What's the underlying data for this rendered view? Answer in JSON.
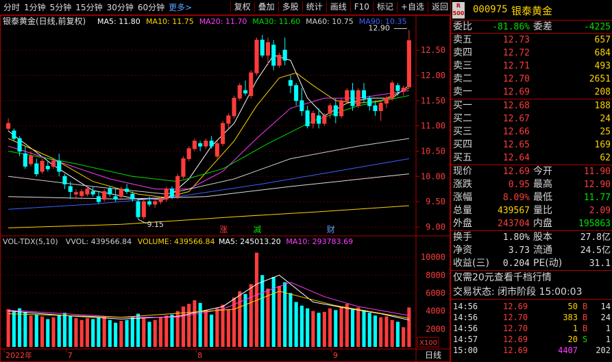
{
  "toolbar": {
    "items": [
      "分时",
      "1分钟",
      "5分钟",
      "15分钟",
      "30分钟",
      "60分钟",
      "更多>"
    ],
    "right": [
      "复权",
      "叠加",
      "多股",
      "统计",
      "画线",
      "F10",
      "标记",
      "+自选",
      "返回"
    ]
  },
  "chart": {
    "title": "银泰黄金(日线,前复权)",
    "ma_labels": [
      {
        "text": "MA5: 11.80",
        "color": "#ffffff"
      },
      {
        "text": "MA10: 11.75",
        "color": "#ffd400"
      },
      {
        "text": "MA20: 11.70",
        "color": "#ff3cff"
      },
      {
        "text": "MA30: 11.60",
        "color": "#00e000"
      },
      {
        "text": "MA60: 10.75",
        "color": "#d0d0d0"
      },
      {
        "text": "MA90: 10.35",
        "color": "#4060ff"
      }
    ],
    "price_ticks": [
      "12.50",
      "12.00",
      "11.50",
      "11.00",
      "10.50",
      "10.00",
      "9.50",
      "9.00"
    ],
    "high_label": "12.90",
    "low_label": "9.15",
    "markers": [
      {
        "t": "涨",
        "c": "#ff3c3c"
      },
      {
        "t": "减",
        "c": "#00e000"
      },
      {
        "t": "财",
        "c": "#5aa0ff"
      }
    ],
    "vol_labels": [
      {
        "text": "VOL-TDX(5,10)",
        "color": "#d0d0d0"
      },
      {
        "text": "VVOL: 439566.84",
        "color": "#d0d0d0"
      },
      {
        "text": "VOLUME: 439566.84",
        "color": "#ffd400"
      },
      {
        "text": "MA5: 245013.20",
        "color": "#ffffff"
      },
      {
        "text": "MA10: 293783.69",
        "color": "#ff3cff"
      }
    ],
    "vol_ticks": [
      "10000",
      "8000",
      "6000",
      "4000",
      "2000"
    ],
    "vol_unit": "X100",
    "x_labels": [
      "2022年",
      "7",
      "8",
      "9"
    ],
    "period": "日线"
  },
  "chart_data": {
    "type": "candlestick",
    "price_range": [
      8.85,
      12.95
    ],
    "vol_range": [
      0,
      11000
    ],
    "candles": [
      [
        10.95,
        11.15,
        10.9,
        11.05
      ],
      [
        10.9,
        10.95,
        10.7,
        10.75
      ],
      [
        10.75,
        10.8,
        10.4,
        10.5
      ],
      [
        10.45,
        10.6,
        10.15,
        10.2
      ],
      [
        10.25,
        10.5,
        10.2,
        10.4
      ],
      [
        10.25,
        10.35,
        10.0,
        10.05
      ],
      [
        10.1,
        10.35,
        10.05,
        10.3
      ],
      [
        10.2,
        10.3,
        10.1,
        10.15
      ],
      [
        10.2,
        10.35,
        10.15,
        10.3
      ],
      [
        10.3,
        10.45,
        10.0,
        10.1
      ],
      [
        10.0,
        10.05,
        9.75,
        9.85
      ],
      [
        9.8,
        9.9,
        9.55,
        9.7
      ],
      [
        9.65,
        9.75,
        9.55,
        9.68
      ],
      [
        9.62,
        9.75,
        9.55,
        9.7
      ],
      [
        9.65,
        9.8,
        9.6,
        9.75
      ],
      [
        9.7,
        9.8,
        9.6,
        9.65
      ],
      [
        9.6,
        9.7,
        9.45,
        9.5
      ],
      [
        9.55,
        9.75,
        9.5,
        9.7
      ],
      [
        9.75,
        9.8,
        9.6,
        9.65
      ],
      [
        9.6,
        9.75,
        9.5,
        9.55
      ],
      [
        9.6,
        9.8,
        9.55,
        9.75
      ],
      [
        9.75,
        9.85,
        9.65,
        9.7
      ],
      [
        9.65,
        9.7,
        9.5,
        9.55
      ],
      [
        9.5,
        9.55,
        9.15,
        9.2
      ],
      [
        9.2,
        9.55,
        9.15,
        9.5
      ],
      [
        9.5,
        9.6,
        9.4,
        9.45
      ],
      [
        9.45,
        9.55,
        9.38,
        9.5
      ],
      [
        9.5,
        9.6,
        9.45,
        9.55
      ],
      [
        9.55,
        9.8,
        9.5,
        9.75
      ],
      [
        9.75,
        9.8,
        9.55,
        9.6
      ],
      [
        9.6,
        10.05,
        9.55,
        10.0
      ],
      [
        10.0,
        10.4,
        9.95,
        10.35
      ],
      [
        10.35,
        10.6,
        10.3,
        10.55
      ],
      [
        10.55,
        10.75,
        10.5,
        10.7
      ],
      [
        10.65,
        10.7,
        10.5,
        10.6
      ],
      [
        10.6,
        10.75,
        10.55,
        10.7
      ],
      [
        10.7,
        10.8,
        10.55,
        10.6
      ],
      [
        10.4,
        10.7,
        10.35,
        10.65
      ],
      [
        10.65,
        11.1,
        10.6,
        11.05
      ],
      [
        11.05,
        11.25,
        10.95,
        11.2
      ],
      [
        11.2,
        11.6,
        11.15,
        11.55
      ],
      [
        11.55,
        11.85,
        11.5,
        11.8
      ],
      [
        11.7,
        11.9,
        11.6,
        11.65
      ],
      [
        11.6,
        12.1,
        11.55,
        12.05
      ],
      [
        12.05,
        12.75,
        12.0,
        12.7
      ],
      [
        12.7,
        12.8,
        12.35,
        12.4
      ],
      [
        12.4,
        12.75,
        12.2,
        12.65
      ],
      [
        12.6,
        12.7,
        12.1,
        12.2
      ],
      [
        12.2,
        12.45,
        12.15,
        12.4
      ],
      [
        12.5,
        12.75,
        12.2,
        12.3
      ],
      [
        11.9,
        12.0,
        11.65,
        11.8
      ],
      [
        11.8,
        11.85,
        11.4,
        11.5
      ],
      [
        11.5,
        11.75,
        11.2,
        11.3
      ],
      [
        11.3,
        11.4,
        10.95,
        11.0
      ],
      [
        11.05,
        11.3,
        10.95,
        11.25
      ],
      [
        11.2,
        11.35,
        10.95,
        11.05
      ],
      [
        11.05,
        11.25,
        11.0,
        11.2
      ],
      [
        11.25,
        11.45,
        11.15,
        11.4
      ],
      [
        11.4,
        11.55,
        11.05,
        11.2
      ],
      [
        11.2,
        11.55,
        11.15,
        11.5
      ],
      [
        11.5,
        11.75,
        11.45,
        11.7
      ],
      [
        11.7,
        11.85,
        11.3,
        11.4
      ],
      [
        11.4,
        11.75,
        11.35,
        11.7
      ],
      [
        11.7,
        11.85,
        11.45,
        11.55
      ],
      [
        11.55,
        11.6,
        11.3,
        11.4
      ],
      [
        11.4,
        11.5,
        11.2,
        11.3
      ],
      [
        11.3,
        11.5,
        11.1,
        11.45
      ],
      [
        11.45,
        11.6,
        11.35,
        11.55
      ],
      [
        11.55,
        11.9,
        11.5,
        11.85
      ],
      [
        11.8,
        11.85,
        11.6,
        11.7
      ],
      [
        11.7,
        11.8,
        11.6,
        11.75
      ],
      [
        11.77,
        12.9,
        11.77,
        12.69
      ]
    ],
    "volumes": [
      4200,
      4000,
      4300,
      3900,
      3500,
      3600,
      3400,
      3100,
      3300,
      3600,
      3800,
      3500,
      3200,
      3000,
      3200,
      3100,
      3300,
      3400,
      3000,
      2700,
      2900,
      3000,
      3400,
      3700,
      3200,
      2800,
      3000,
      3300,
      3500,
      3600,
      4000,
      4500,
      4800,
      5200,
      4900,
      4100,
      3600,
      4300,
      4700,
      4200,
      5500,
      6200,
      5900,
      7000,
      10500,
      8000,
      6500,
      7800,
      6800,
      7200,
      6000,
      5000,
      4600,
      4300,
      4000,
      3800,
      3900,
      4300,
      4100,
      4500,
      4800,
      4200,
      4400,
      4100,
      3800,
      3500,
      3300,
      3400,
      3000,
      2800,
      2200,
      4397
    ],
    "ma": [
      {
        "name": "MA5",
        "color": "#ffffff",
        "values": [
          [
            0,
            10.9
          ],
          [
            8,
            10.22
          ],
          [
            15,
            9.72
          ],
          [
            23,
            9.55
          ],
          [
            28,
            9.55
          ],
          [
            32,
            9.95
          ],
          [
            36,
            10.6
          ],
          [
            40,
            11.05
          ],
          [
            44,
            11.9
          ],
          [
            47,
            12.4
          ],
          [
            50,
            12.3
          ],
          [
            53,
            11.55
          ],
          [
            56,
            11.2
          ],
          [
            60,
            11.45
          ],
          [
            64,
            11.55
          ],
          [
            68,
            11.55
          ],
          [
            71,
            11.8
          ]
        ]
      },
      {
        "name": "MA10",
        "color": "#ffd400",
        "values": [
          [
            0,
            10.75
          ],
          [
            8,
            10.35
          ],
          [
            15,
            9.9
          ],
          [
            23,
            9.65
          ],
          [
            28,
            9.58
          ],
          [
            32,
            9.7
          ],
          [
            36,
            10.2
          ],
          [
            40,
            10.7
          ],
          [
            44,
            11.4
          ],
          [
            48,
            11.95
          ],
          [
            51,
            12.05
          ],
          [
            54,
            11.8
          ],
          [
            58,
            11.5
          ],
          [
            62,
            11.45
          ],
          [
            66,
            11.5
          ],
          [
            71,
            11.75
          ]
        ]
      },
      {
        "name": "MA20",
        "color": "#ff3cff",
        "values": [
          [
            0,
            10.6
          ],
          [
            10,
            10.25
          ],
          [
            18,
            9.95
          ],
          [
            26,
            9.75
          ],
          [
            32,
            9.75
          ],
          [
            38,
            10.1
          ],
          [
            44,
            10.75
          ],
          [
            50,
            11.35
          ],
          [
            56,
            11.55
          ],
          [
            62,
            11.55
          ],
          [
            71,
            11.7
          ]
        ]
      },
      {
        "name": "MA30",
        "color": "#00e000",
        "values": [
          [
            0,
            10.5
          ],
          [
            12,
            10.25
          ],
          [
            22,
            10.0
          ],
          [
            30,
            9.9
          ],
          [
            38,
            10.15
          ],
          [
            46,
            10.65
          ],
          [
            54,
            11.1
          ],
          [
            62,
            11.4
          ],
          [
            71,
            11.6
          ]
        ]
      },
      {
        "name": "MA60",
        "color": "#d0d0d0",
        "values": [
          [
            0,
            10.0
          ],
          [
            15,
            9.8
          ],
          [
            28,
            9.65
          ],
          [
            40,
            9.95
          ],
          [
            50,
            10.35
          ],
          [
            62,
            10.6
          ],
          [
            71,
            10.75
          ]
        ]
      },
      {
        "name": "MA90",
        "color": "#4060ff",
        "values": [
          [
            0,
            9.35
          ],
          [
            15,
            9.45
          ],
          [
            30,
            9.6
          ],
          [
            45,
            9.85
          ],
          [
            58,
            10.1
          ],
          [
            71,
            10.35
          ]
        ]
      },
      {
        "name": "MA-long",
        "color": "#ffd400",
        "values": [
          [
            0,
            8.98
          ],
          [
            20,
            9.05
          ],
          [
            40,
            9.2
          ],
          [
            55,
            9.3
          ],
          [
            71,
            9.42
          ]
        ]
      },
      {
        "name": "MA-x",
        "color": "#e0e0e0",
        "values": [
          [
            0,
            9.6
          ],
          [
            20,
            9.55
          ],
          [
            35,
            9.6
          ],
          [
            50,
            9.8
          ],
          [
            71,
            10.05
          ]
        ]
      }
    ],
    "vol_ma": [
      {
        "name": "MA5",
        "color": "#ffffff",
        "values": [
          [
            0,
            4000
          ],
          [
            10,
            3500
          ],
          [
            20,
            3100
          ],
          [
            30,
            3400
          ],
          [
            38,
            4500
          ],
          [
            44,
            7000
          ],
          [
            48,
            8000
          ],
          [
            54,
            5000
          ],
          [
            60,
            4300
          ],
          [
            66,
            3700
          ],
          [
            71,
            3000
          ]
        ]
      },
      {
        "name": "MA10",
        "color": "#ff3cff",
        "values": [
          [
            0,
            4100
          ],
          [
            10,
            3700
          ],
          [
            20,
            3300
          ],
          [
            30,
            3300
          ],
          [
            38,
            4200
          ],
          [
            44,
            5800
          ],
          [
            50,
            7200
          ],
          [
            56,
            5600
          ],
          [
            62,
            4500
          ],
          [
            71,
            3500
          ]
        ]
      },
      {
        "name": "MA-y",
        "color": "#ffd400",
        "values": [
          [
            0,
            3700
          ],
          [
            20,
            3300
          ],
          [
            40,
            4200
          ],
          [
            48,
            6200
          ],
          [
            58,
            4600
          ],
          [
            71,
            3200
          ]
        ]
      }
    ]
  },
  "quote": {
    "code": "000975",
    "name": "银泰黄金",
    "r_box": [
      "R",
      "500"
    ],
    "weibi_l": "委比",
    "weibi": "-81.86%",
    "weicha_l": "委差",
    "weicha": "-4225",
    "asks": [
      {
        "l": "卖五",
        "p": "12.73",
        "v": "657"
      },
      {
        "l": "卖四",
        "p": "12.72",
        "v": "684"
      },
      {
        "l": "卖三",
        "p": "12.71",
        "v": "493"
      },
      {
        "l": "卖二",
        "p": "12.70",
        "v": "2651"
      },
      {
        "l": "卖一",
        "p": "12.69",
        "v": "208"
      }
    ],
    "bids": [
      {
        "l": "买一",
        "p": "12.68",
        "v": "188"
      },
      {
        "l": "买二",
        "p": "12.67",
        "v": "24"
      },
      {
        "l": "买三",
        "p": "12.66",
        "v": "25"
      },
      {
        "l": "买四",
        "p": "12.65",
        "v": "169"
      },
      {
        "l": "买五",
        "p": "12.64",
        "v": "62"
      }
    ],
    "stats": [
      {
        "l1": "现价",
        "v1": "12.69",
        "l2": "今开",
        "v2": "11.90"
      },
      {
        "l1": "涨跌",
        "v1": "0.95",
        "l2": "最高",
        "v2": "12.90"
      },
      {
        "l1": "涨幅",
        "v1": "8.09%",
        "l2": "最低",
        "v2": "11.77"
      },
      {
        "l1": "总量",
        "v1": "439567",
        "l2": "量比",
        "v2": "2.09"
      },
      {
        "l1": "外盘",
        "v1": "243704",
        "l2": "内盘",
        "v2": "195863"
      }
    ],
    "stats2": [
      {
        "l1": "换手",
        "v1": "1.80%",
        "l2": "股本",
        "v2": "27.8亿"
      },
      {
        "l1": "净资",
        "v1": "3.73",
        "l2": "流通",
        "v2": "24.5亿"
      },
      {
        "l1": "收益(三)",
        "v1": "0.204",
        "l2": "PE(动)",
        "v2": "31.1"
      }
    ],
    "promo": "仅需20元查看千档行情",
    "status": "交易状态: 闭市阶段 15:00:03",
    "ticks": [
      {
        "t": "14:56",
        "p": "12.69",
        "v": "50",
        "s": "B",
        "n": "14"
      },
      {
        "t": "14:56",
        "p": "12.70",
        "v": "383",
        "s": "B",
        "n": "24"
      },
      {
        "t": "14:56",
        "p": "12.70",
        "v": "1",
        "s": "B",
        "n": "1"
      },
      {
        "t": "14:57",
        "p": "12.69",
        "v": "20",
        "s": "S",
        "n": "1"
      },
      {
        "t": "15:00",
        "p": "12.69",
        "v": "4407",
        "s": "",
        "n": "202"
      }
    ]
  }
}
